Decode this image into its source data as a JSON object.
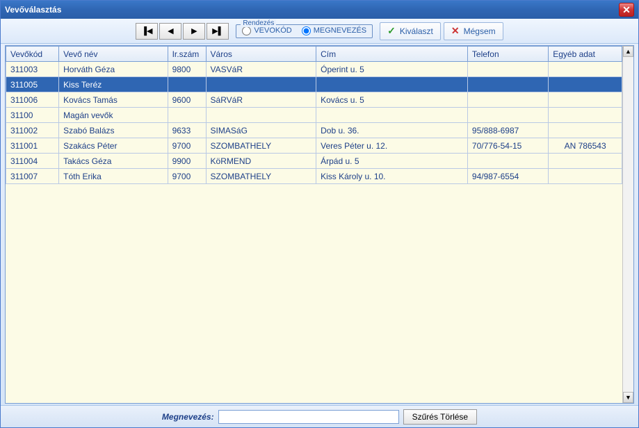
{
  "window": {
    "title": "Vevőválasztás"
  },
  "toolbar": {
    "sort_legend": "Rendezés",
    "sort_opt_code": "VEVŐKÓD",
    "sort_opt_name": "MEGNEVEZÉS",
    "sort_selected": "name",
    "btn_select": "Kiválaszt",
    "btn_cancel": "Mégsem"
  },
  "grid": {
    "headers": {
      "vevokod": "Vevőkód",
      "nev": "Vevő név",
      "irszam": "Ir.szám",
      "varos": "Város",
      "cim": "Cím",
      "telefon": "Telefon",
      "egyeb": "Egyéb adat"
    },
    "selected_index": 1,
    "rows": [
      {
        "vevokod": "311003",
        "nev": "Horváth Géza",
        "irszam": "9800",
        "varos": "VASVáR",
        "cim": "Óperint u. 5",
        "telefon": "",
        "egyeb": ""
      },
      {
        "vevokod": "311005",
        "nev": "Kiss Teréz",
        "irszam": "",
        "varos": "",
        "cim": "",
        "telefon": "",
        "egyeb": ""
      },
      {
        "vevokod": "311006",
        "nev": "Kovács Tamás",
        "irszam": "9600",
        "varos": "SáRVáR",
        "cim": "Kovács u. 5",
        "telefon": "",
        "egyeb": ""
      },
      {
        "vevokod": "31100",
        "nev": "Magán vevők",
        "irszam": "",
        "varos": "",
        "cim": "",
        "telefon": "",
        "egyeb": ""
      },
      {
        "vevokod": "311002",
        "nev": "Szabó Balázs",
        "irszam": "9633",
        "varos": "SIMASáG",
        "cim": "Dob u. 36.",
        "telefon": "95/888-6987",
        "egyeb": ""
      },
      {
        "vevokod": "311001",
        "nev": "Szakács Péter",
        "irszam": "9700",
        "varos": "SZOMBATHELY",
        "cim": "Veres Péter u. 12.",
        "telefon": "70/776-54-15",
        "egyeb": "AN 786543"
      },
      {
        "vevokod": "311004",
        "nev": "Takács Géza",
        "irszam": "9900",
        "varos": "KöRMEND",
        "cim": "Árpád u. 5",
        "telefon": "",
        "egyeb": ""
      },
      {
        "vevokod": "311007",
        "nev": "Tóth Erika",
        "irszam": "9700",
        "varos": "SZOMBATHELY",
        "cim": "Kiss Károly u. 10.",
        "telefon": "94/987-6554",
        "egyeb": ""
      }
    ]
  },
  "footer": {
    "label": "Megnevezés:",
    "filter_value": "",
    "clear_btn": "Szűrés Törlése"
  }
}
